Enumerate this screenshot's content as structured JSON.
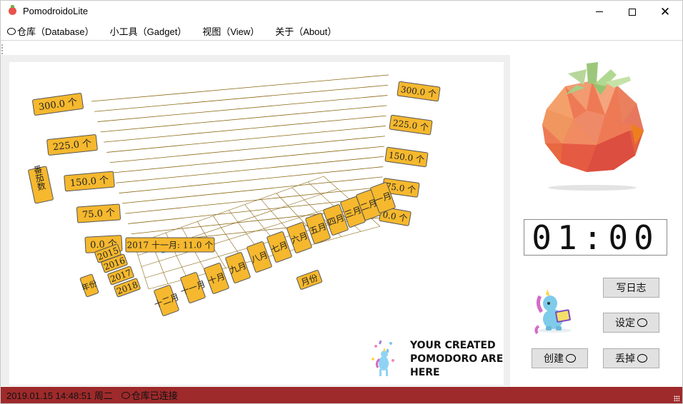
{
  "window": {
    "title": "PomodroidoLite"
  },
  "menu": {
    "items": [
      {
        "label": "仓库（Database）",
        "icon": "tomato-icon"
      },
      {
        "label": "小工具（Gadget）"
      },
      {
        "label": "视图（View）"
      },
      {
        "label": "关于（About）"
      }
    ]
  },
  "chart_data": {
    "type": "bar3d",
    "z_axis_label": "番茄数",
    "z_ticks": [
      "0.0 个",
      "75.0 个",
      "150.0 个",
      "225.0 个",
      "300.0 个"
    ],
    "z_range": [
      0,
      300
    ],
    "years": [
      "2015",
      "2016",
      "2017",
      "2018"
    ],
    "year_axis_label": "年份",
    "months": [
      "一月",
      "二月",
      "三月",
      "四月",
      "五月",
      "六月",
      "七月",
      "八月",
      "九月",
      "十月",
      "十一月",
      "十二月"
    ],
    "month_axis_label": "月份",
    "bars": [
      {
        "year": "2017",
        "month": "十一月",
        "value": 11.0
      }
    ],
    "tooltip": "2017 十一月: 11.0 个",
    "bar_color": "#1a7fd4",
    "label_fill": "#f5b82e",
    "grid_color": "#8b6914"
  },
  "promo": {
    "text": "YOUR CREATED\nPOMODORO ARE\nHERE"
  },
  "timer": {
    "value": "01:00"
  },
  "buttons": {
    "write_log": "写日志",
    "settings": "设定",
    "create": "创建",
    "discard": "丢掉"
  },
  "status": {
    "datetime": "2019.01.15 14:48:51 周二",
    "db_status": "仓库已连接",
    "bar_color": "#9e2a2b"
  }
}
